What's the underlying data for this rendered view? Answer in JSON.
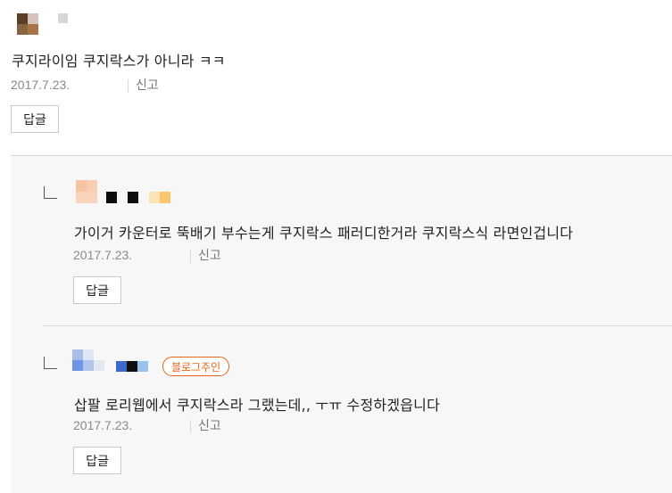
{
  "comment": {
    "text": "쿠지라이임 쿠지락스가 아니라 ㅋㅋ",
    "date": "2017.7.23.",
    "report_label": "신고",
    "reply_label": "답글"
  },
  "replies": [
    {
      "text": "가이거 카운터로 뚝배기 부수는게 쿠지락스 패러디한거라 쿠지락스식 라면인겁니다",
      "date": "2017.7.23.",
      "report_label": "신고",
      "reply_label": "답글"
    },
    {
      "badge": "블로그주인",
      "text": "삽팔 로리웹에서 쿠지락스라 그랬는데,, ㅜㅠ 수정하겠읍니다",
      "date": "2017.7.23.",
      "report_label": "신고",
      "reply_label": "답글"
    }
  ],
  "colors": {
    "badge": "#e8651d",
    "meta": "#8a8a8a",
    "reply_background": "#f7f7f7"
  }
}
